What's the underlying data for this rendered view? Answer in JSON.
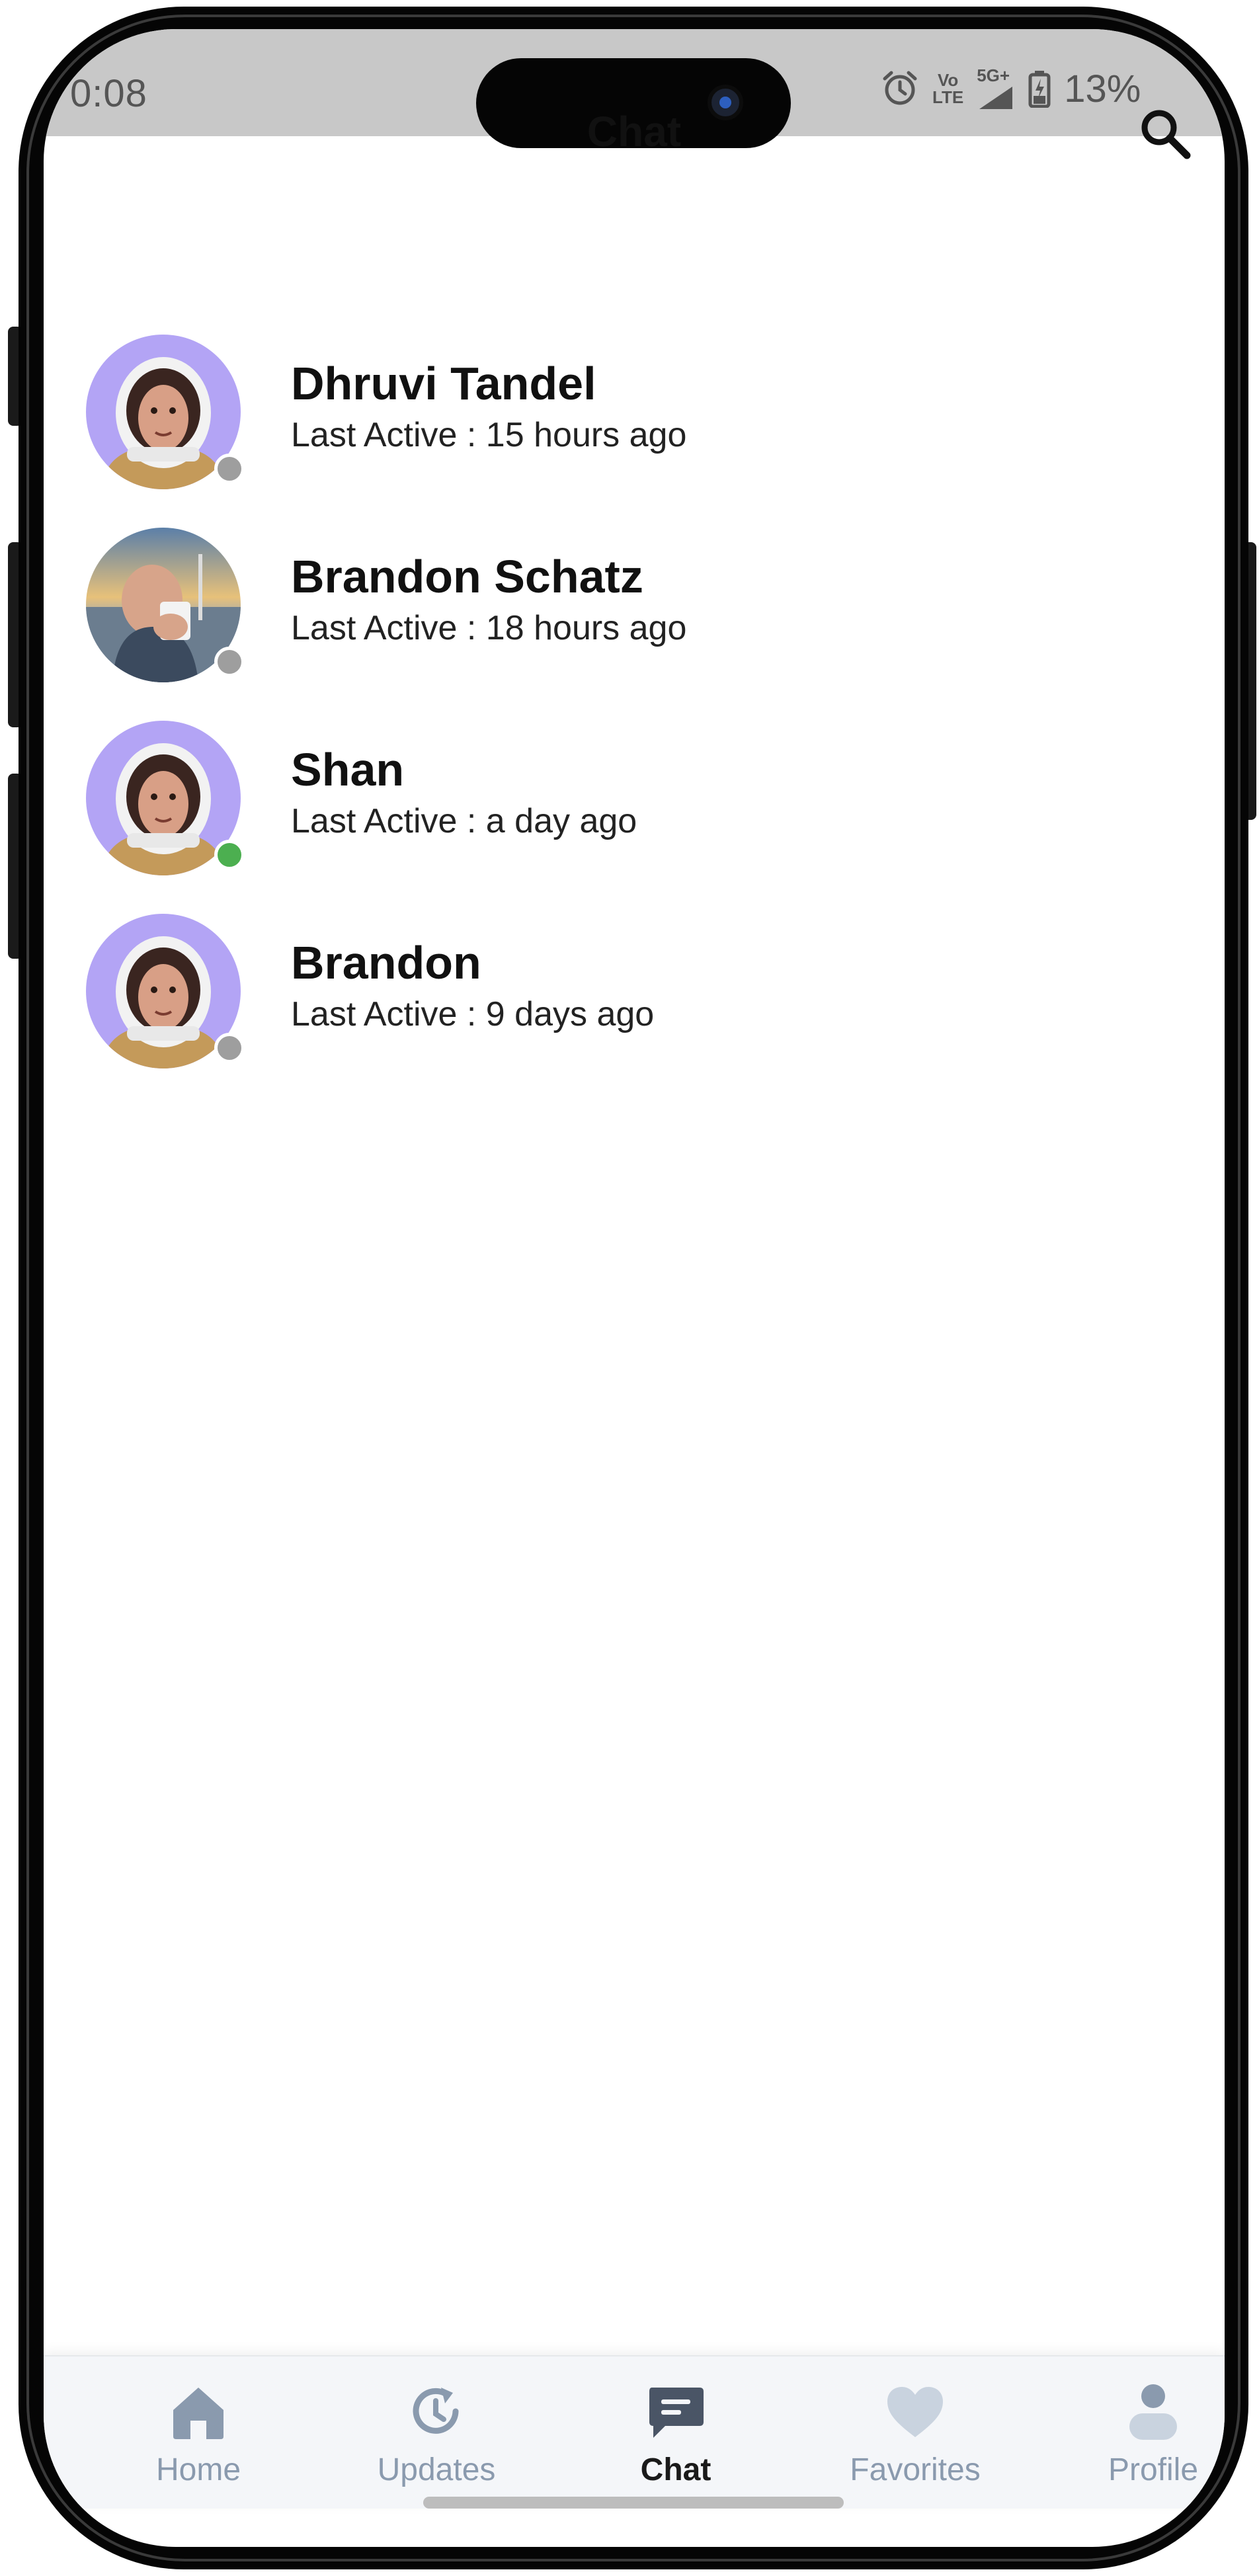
{
  "status_bar": {
    "time": "0:08",
    "network_volte": "Vo",
    "network_lte": "LTE",
    "network_5g": "5G+",
    "battery": "13%"
  },
  "header": {
    "title": "Chat"
  },
  "chats": [
    {
      "name": "Dhruvi Tandel",
      "last_active": "Last Active : 15 hours ago",
      "avatar": "astronaut",
      "online": false
    },
    {
      "name": "Brandon Schatz",
      "last_active": "Last Active : 18 hours ago",
      "avatar": "photo",
      "online": false
    },
    {
      "name": "Shan",
      "last_active": "Last Active : a day ago",
      "avatar": "astronaut",
      "online": true
    },
    {
      "name": "Brandon",
      "last_active": "Last Active : 9 days ago",
      "avatar": "astronaut",
      "online": false
    }
  ],
  "nav": [
    {
      "label": "Home",
      "icon": "home-icon",
      "active": false
    },
    {
      "label": "Updates",
      "icon": "updates-icon",
      "active": false
    },
    {
      "label": "Chat",
      "icon": "chat-icon",
      "active": true
    },
    {
      "label": "Favorites",
      "icon": "heart-icon",
      "active": false
    },
    {
      "label": "Profile",
      "icon": "profile-icon",
      "active": false
    }
  ],
  "colors": {
    "online": "#4caf50",
    "offline": "#9e9e9e",
    "avatar_bg": "#b3a4f5",
    "nav_inactive": "#8a9aae",
    "nav_active": "#1a1a1a"
  }
}
